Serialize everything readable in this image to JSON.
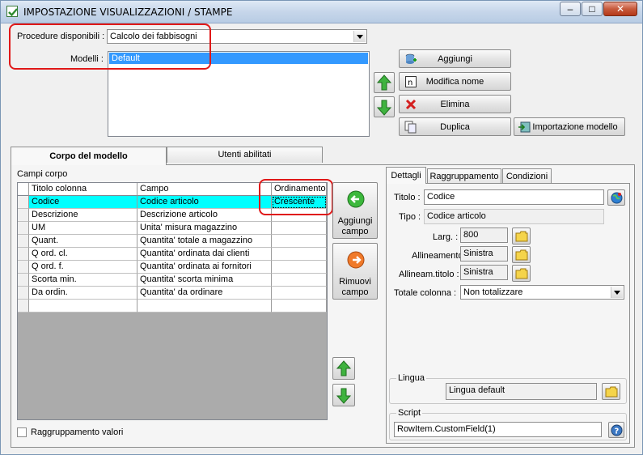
{
  "window": {
    "title": "IMPOSTAZIONE VISUALIZZAZIONI / STAMPE"
  },
  "top": {
    "procedures_label": "Procedure disponibili :",
    "procedure_value": "Calcolo dei fabbisogni",
    "models_label": "Modelli :",
    "models": [
      "Default"
    ],
    "buttons": {
      "add": "Aggiungi",
      "rename": "Modifica nome",
      "delete": "Elimina",
      "duplicate": "Duplica",
      "import": "Importazione modello"
    }
  },
  "tabs": {
    "body": "Corpo del modello",
    "users": "Utenti abilitati"
  },
  "body": {
    "section_label": "Campi corpo",
    "columns": [
      "Titolo colonna",
      "Campo",
      "Ordinamento"
    ],
    "rows": [
      [
        "Codice",
        "Codice articolo",
        "Crescente"
      ],
      [
        "Descrizione",
        "Descrizione articolo",
        ""
      ],
      [
        "UM",
        "Unita' misura magazzino",
        ""
      ],
      [
        "Quant.",
        "Quantita' totale a magazzino",
        ""
      ],
      [
        "Q ord. cl.",
        "Quantita' ordinata dai clienti",
        ""
      ],
      [
        "Q ord. f.",
        "Quantita' ordinata ai fornitori",
        ""
      ],
      [
        "Scorta min.",
        "Quantita' scorta minima",
        ""
      ],
      [
        "Da ordin.",
        "Quantita' da ordinare",
        ""
      ]
    ],
    "add_field": [
      "Aggiungi",
      "campo"
    ],
    "remove_field": [
      "Rimuovi",
      "campo"
    ],
    "group_values": "Raggruppamento valori"
  },
  "details": {
    "tabs": [
      "Dettagli",
      "Raggruppamento",
      "Condizioni"
    ],
    "title_label": "Titolo :",
    "title_value": "Codice",
    "type_label": "Tipo :",
    "type_value": "Codice articolo",
    "width_label": "Larg. :",
    "width_value": "800",
    "align_label": "Allineamento :",
    "align_value": "Sinistra",
    "title_align_label": "Allineam.titolo :",
    "title_align_value": "Sinistra",
    "total_label": "Totale colonna :",
    "total_value": "Non totalizzare",
    "language_group": "Lingua",
    "language_value": "Lingua default",
    "script_group": "Script",
    "script_value": "RowItem.CustomField(1)"
  },
  "colors": {
    "highlight": "#3399ff",
    "current_row": "#00ffff",
    "annotation": "#e01818",
    "arrow_green": "#2f9e2f"
  }
}
